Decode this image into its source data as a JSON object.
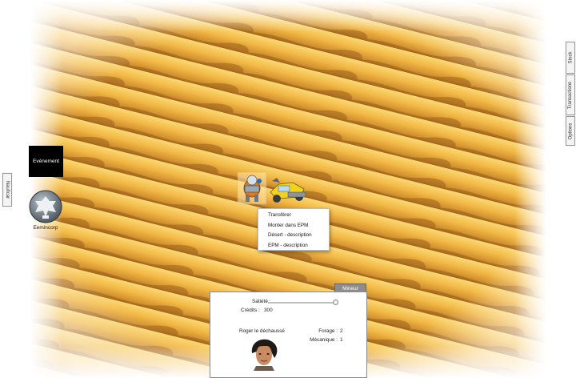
{
  "side_tabs": {
    "stock": "Stock",
    "transactions": "Transactions",
    "options": "Options",
    "left": "Nauficar"
  },
  "event_box": {
    "label": "Evénement"
  },
  "corp": {
    "name": "Eemincorp"
  },
  "context_menu": {
    "items": [
      "Transférer",
      "Monter dans EPM",
      "Désert - description",
      "EPM - description"
    ]
  },
  "panel": {
    "tab_label": "Mineur",
    "satiety_label": "Satiété :",
    "satiety_level": 1.0,
    "credits_label": "Crédits :",
    "credits_value": "300",
    "character_name": "Roger le déchaussé",
    "skills": [
      {
        "label": "Forage :",
        "value": "2"
      },
      {
        "label": "Mécanique :",
        "value": "1"
      }
    ]
  },
  "colors": {
    "sand_light": "#f6c553",
    "sand_dark": "#c7872a",
    "event_bg": "#000000",
    "panel_tab": "#8d8d8d"
  },
  "icons": [
    "corp-logo-icon",
    "miner-unit-icon",
    "epm-vehicle-icon",
    "character-portrait"
  ]
}
